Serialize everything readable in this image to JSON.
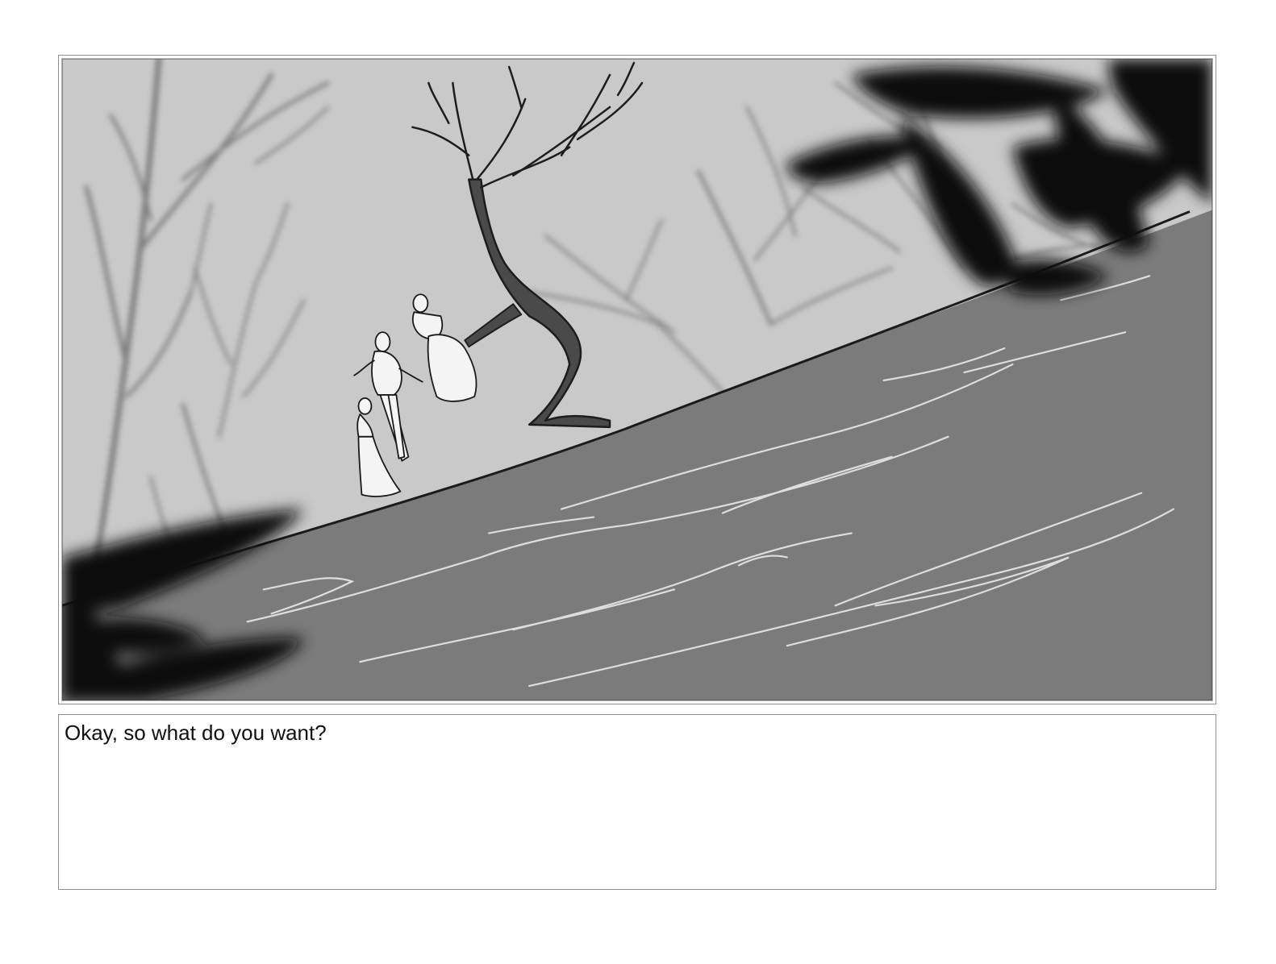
{
  "storyboard": {
    "caption": "Okay, so what do you want?"
  },
  "colors": {
    "sky": "#c9c9c9",
    "hill": "#7b7b7b",
    "foliage": "#0f0f0f",
    "figures": "#f4f4f4",
    "frame": "#8f8f8f"
  }
}
